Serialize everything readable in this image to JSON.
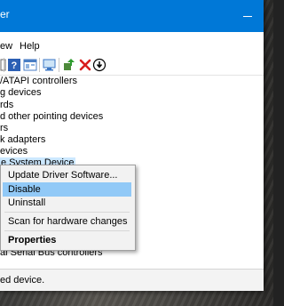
{
  "window": {
    "title": "er"
  },
  "menu": {
    "items": [
      "ew",
      "Help"
    ]
  },
  "toolbar": {
    "icons": [
      "properties-icon",
      "help-icon",
      "view-icon",
      "scan-hardware-icon",
      "update-driver-icon",
      "uninstall-icon",
      "disable-icon"
    ]
  },
  "tree": {
    "items": [
      "/ATAPI controllers",
      "g devices",
      "rds",
      "d other pointing devices",
      "rs",
      "k adapters",
      "evices",
      "e System Device"
    ],
    "last_item": "al Serial Bus controllers"
  },
  "context_menu": {
    "items": [
      "Update Driver Software...",
      "Disable",
      "Uninstall",
      "Scan for hardware changes",
      "Properties"
    ]
  },
  "status": {
    "text": "ed device."
  },
  "colors": {
    "titlebar": "#0078d7",
    "hover": "#91c9f7",
    "selected": "#cce8ff"
  }
}
